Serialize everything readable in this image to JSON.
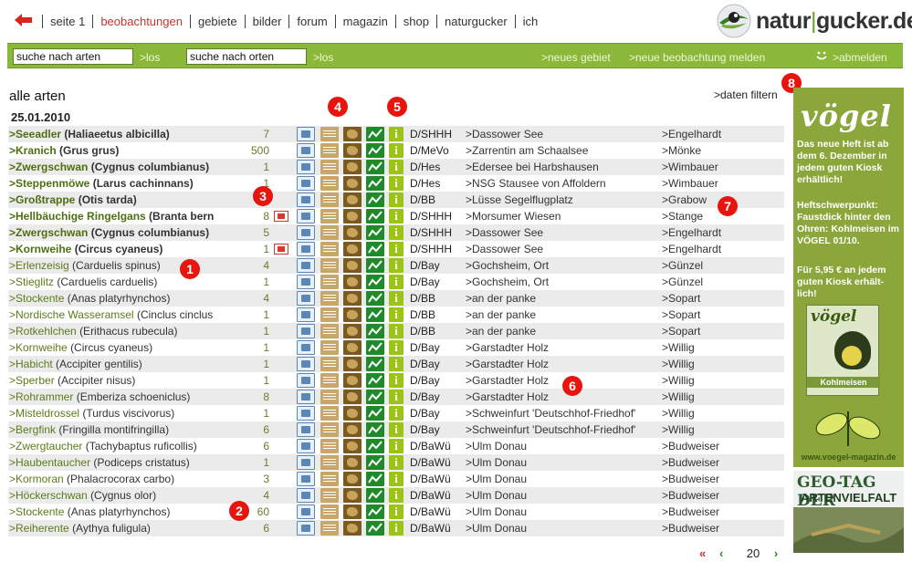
{
  "nav": {
    "items": [
      "seite 1",
      "beobachtungen",
      "gebiete",
      "bilder",
      "forum",
      "magazin",
      "shop",
      "naturgucker",
      "ich"
    ],
    "active_index": 1
  },
  "logo": {
    "left": "natur",
    "sep": "|",
    "right": "gucker.de"
  },
  "search": {
    "arten_value": "suche nach arten",
    "orte_value": "suche nach orten",
    "go_label_1": ">los",
    "go_label_2": ">los",
    "new_area": ">neues gebiet",
    "new_observation": ">neue beobachtung melden",
    "logout": ">abmelden"
  },
  "main": {
    "heading": "alle arten",
    "date": "25.01.2010",
    "filter_link": ">daten filtern"
  },
  "info_glyph": "i",
  "rows": [
    {
      "name": ">Seeadler",
      "latin": "(Haliaeetus albicilla)",
      "bold": true,
      "count": "7",
      "badge": false,
      "region": "D/SHHH",
      "place": ">Dassower See",
      "observer": ">Engelhardt"
    },
    {
      "name": ">Kranich",
      "latin": "(Grus grus)",
      "bold": true,
      "count": "500",
      "badge": false,
      "region": "D/MeVo",
      "place": ">Zarrentin am Schaalsee",
      "observer": ">Mönke"
    },
    {
      "name": ">Zwergschwan",
      "latin": "(Cygnus columbianus)",
      "bold": true,
      "count": "1",
      "badge": false,
      "region": "D/Hes",
      "place": ">Edersee bei Harbshausen",
      "observer": ">Wimbauer"
    },
    {
      "name": ">Steppenmöwe",
      "latin": "(Larus cachinnans)",
      "bold": true,
      "count": "1",
      "badge": false,
      "region": "D/Hes",
      "place": ">NSG Stausee von Affoldern",
      "observer": ">Wimbauer"
    },
    {
      "name": ">Großtrappe",
      "latin": "(Otis tarda)",
      "bold": true,
      "count": "",
      "badge": false,
      "region": "D/BB",
      "place": ">Lüsse Segelflugplatz",
      "observer": ">Grabow"
    },
    {
      "name": ">Hellbäuchige Ringelgans",
      "latin": "(Branta bern",
      "bold": true,
      "count": "8",
      "badge": true,
      "region": "D/SHHH",
      "place": ">Morsumer Wiesen",
      "observer": ">Stange"
    },
    {
      "name": ">Zwergschwan",
      "latin": "(Cygnus columbianus)",
      "bold": true,
      "count": "5",
      "badge": false,
      "region": "D/SHHH",
      "place": ">Dassower See",
      "observer": ">Engelhardt"
    },
    {
      "name": ">Kornweihe",
      "latin": "(Circus cyaneus)",
      "bold": true,
      "count": "1",
      "badge": true,
      "region": "D/SHHH",
      "place": ">Dassower See",
      "observer": ">Engelhardt"
    },
    {
      "name": ">Erlenzeisig",
      "latin": "(Carduelis spinus)",
      "bold": false,
      "count": "4",
      "badge": false,
      "region": "D/Bay",
      "place": ">Gochsheim, Ort",
      "observer": ">Günzel"
    },
    {
      "name": ">Stieglitz",
      "latin": "(Carduelis carduelis)",
      "bold": false,
      "count": "1",
      "badge": false,
      "region": "D/Bay",
      "place": ">Gochsheim, Ort",
      "observer": ">Günzel"
    },
    {
      "name": ">Stockente",
      "latin": "(Anas platyrhynchos)",
      "bold": false,
      "count": "4",
      "badge": false,
      "region": "D/BB",
      "place": ">an der panke",
      "observer": ">Sopart"
    },
    {
      "name": ">Nordische Wasseramsel",
      "latin": "(Cinclus cinclus",
      "bold": false,
      "count": "1",
      "badge": false,
      "region": "D/BB",
      "place": ">an der panke",
      "observer": ">Sopart"
    },
    {
      "name": ">Rotkehlchen",
      "latin": "(Erithacus rubecula)",
      "bold": false,
      "count": "1",
      "badge": false,
      "region": "D/BB",
      "place": ">an der panke",
      "observer": ">Sopart"
    },
    {
      "name": ">Kornweihe",
      "latin": "(Circus cyaneus)",
      "bold": false,
      "count": "1",
      "badge": false,
      "region": "D/Bay",
      "place": ">Garstadter Holz",
      "observer": ">Willig"
    },
    {
      "name": ">Habicht",
      "latin": "(Accipiter gentilis)",
      "bold": false,
      "count": "1",
      "badge": false,
      "region": "D/Bay",
      "place": ">Garstadter Holz",
      "observer": ">Willig"
    },
    {
      "name": ">Sperber",
      "latin": "(Accipiter nisus)",
      "bold": false,
      "count": "1",
      "badge": false,
      "region": "D/Bay",
      "place": ">Garstadter Holz",
      "observer": ">Willig"
    },
    {
      "name": ">Rohrammer",
      "latin": "(Emberiza schoeniclus)",
      "bold": false,
      "count": "8",
      "badge": false,
      "region": "D/Bay",
      "place": ">Garstadter Holz",
      "observer": ">Willig"
    },
    {
      "name": ">Misteldrossel",
      "latin": "(Turdus viscivorus)",
      "bold": false,
      "count": "1",
      "badge": false,
      "region": "D/Bay",
      "place": ">Schweinfurt 'Deutschhof-Friedhof'",
      "observer": ">Willig"
    },
    {
      "name": ">Bergfink",
      "latin": "(Fringilla montifringilla)",
      "bold": false,
      "count": "6",
      "badge": false,
      "region": "D/Bay",
      "place": ">Schweinfurt 'Deutschhof-Friedhof'",
      "observer": ">Willig"
    },
    {
      "name": ">Zwergtaucher",
      "latin": "(Tachybaptus ruficollis)",
      "bold": false,
      "count": "6",
      "badge": false,
      "region": "D/BaWü",
      "place": ">Ulm Donau",
      "observer": ">Budweiser"
    },
    {
      "name": ">Haubentaucher",
      "latin": "(Podiceps cristatus)",
      "bold": false,
      "count": "1",
      "badge": false,
      "region": "D/BaWü",
      "place": ">Ulm Donau",
      "observer": ">Budweiser"
    },
    {
      "name": ">Kormoran",
      "latin": "(Phalacrocorax carbo)",
      "bold": false,
      "count": "3",
      "badge": false,
      "region": "D/BaWü",
      "place": ">Ulm Donau",
      "observer": ">Budweiser"
    },
    {
      "name": ">Höckerschwan",
      "latin": "(Cygnus olor)",
      "bold": false,
      "count": "4",
      "badge": false,
      "region": "D/BaWü",
      "place": ">Ulm Donau",
      "observer": ">Budweiser"
    },
    {
      "name": ">Stockente",
      "latin": "(Anas platyrhynchos)",
      "bold": false,
      "count": "60",
      "badge": false,
      "region": "D/BaWü",
      "place": ">Ulm Donau",
      "observer": ">Budweiser"
    },
    {
      "name": ">Reiherente",
      "latin": "(Aythya fuligula)",
      "bold": false,
      "count": "6",
      "badge": false,
      "region": "D/BaWü",
      "place": ">Ulm Donau",
      "observer": ">Budweiser"
    }
  ],
  "markers": [
    "1",
    "2",
    "3",
    "4",
    "5",
    "6",
    "7",
    "8"
  ],
  "pagination": {
    "first": "«",
    "prev": "‹",
    "page": "20",
    "next": "›"
  },
  "ad_voegel": {
    "title": "vögel",
    "text1": "Das neue Heft ist ab dem 6. Dezember in jedem guten Kiosk erhältlich!",
    "text2": "Heftschwerpunkt: Faustdick hinter den Ohren: Kohlmeisen im VÖGEL 01/10.",
    "text3": "Für 5,95 € an jedem guten Kiosk erhält-lich!",
    "cover_title": "vögel",
    "cover_band": "Kohlmeisen",
    "url": "www.voegel-magazin.de"
  },
  "ad_geo": {
    "line1": "GEO-TAG DER",
    "line2": "ARTENVIELFALT"
  },
  "colors": {
    "accent_green": "#8cb83a",
    "nav_active": "#c0392b",
    "marker_red": "#e8150f"
  }
}
